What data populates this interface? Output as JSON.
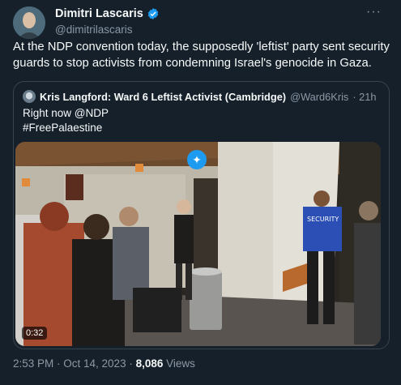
{
  "author": {
    "display_name": "Dimitri Lascaris",
    "handle": "@dimitrilascaris",
    "verified": true,
    "avatar_icon": "avatar"
  },
  "more_icon": "···",
  "tweet_text": "At the NDP convention today, the supposedly 'leftist' party sent security guards to stop activists from condemning Israel's genocide in Gaza.",
  "quote": {
    "display_name": "Kris Langford: Ward 6 Leftist Activist (Cambridge)",
    "handle": "@Ward6Kris",
    "time": "· 21h",
    "text_line1": "Right now @NDP",
    "text_line2": "#FreePalaestine",
    "video_duration": "0:32",
    "grok_icon": "✦",
    "jacket_label": "SECURITY"
  },
  "meta": {
    "time": "2:53 PM · Oct 14, 2023 · ",
    "views": "8,086",
    "views_label": " Views"
  },
  "colors": {
    "background": "#15202b",
    "text": "#f7f9f9",
    "secondary": "#8b98a5",
    "border": "#38444d",
    "accent": "#1d9bf0"
  }
}
